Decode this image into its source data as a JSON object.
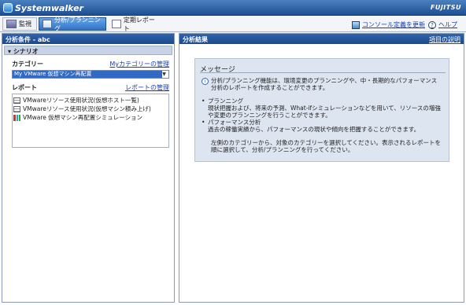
{
  "app": {
    "title": "Systemwalker",
    "vendor": "FUJITSU"
  },
  "toolbar": {
    "tabs": [
      {
        "label": "監視"
      },
      {
        "label": "分析/プランニング"
      },
      {
        "label": "定期レポート"
      }
    ],
    "update_link": "コンソール定義を更新",
    "help_link": "ヘルプ"
  },
  "left_panel": {
    "title": "分析条件 - abc",
    "section_label": "シナリオ",
    "category_label": "カテゴリー",
    "category_manage_link": "Myカテゴリーの管理",
    "category_selected": "My VMware 仮想マシン再配置",
    "report_label": "レポート",
    "report_manage_link": "レポートの管理",
    "reports": [
      {
        "label": "VMwareリソース使用状況(仮想ホスト一覧)"
      },
      {
        "label": "VMwareリソース使用状況(仮想マシン積み上げ)"
      },
      {
        "label": "VMware 仮想マシン再配置シミュレーション"
      }
    ]
  },
  "right_panel": {
    "title": "分析結果",
    "explain_link": "項目の説明",
    "message_title": "メッセージ",
    "intro": "分析/プランニング機能は、環境変更のプランニングや、中・長期的なパフォーマンス分析のレポートを作成することができます。",
    "bullets": [
      {
        "head": "プランニング",
        "desc": "現状把握および、将来の予測、What-ifシミュレーションなどを用いて、リソースの増強や変更のプランニングを行うことができます。"
      },
      {
        "head": "パフォーマンス分析",
        "desc": "過去の稼働実績から、パフォーマンスの現状や傾向を把握することができます。"
      }
    ],
    "closing": "左側のカテゴリーから、対象のカテゴリーを選択してください。表示されるレポートを順に選択して、分析/プランニングを行ってください。"
  }
}
